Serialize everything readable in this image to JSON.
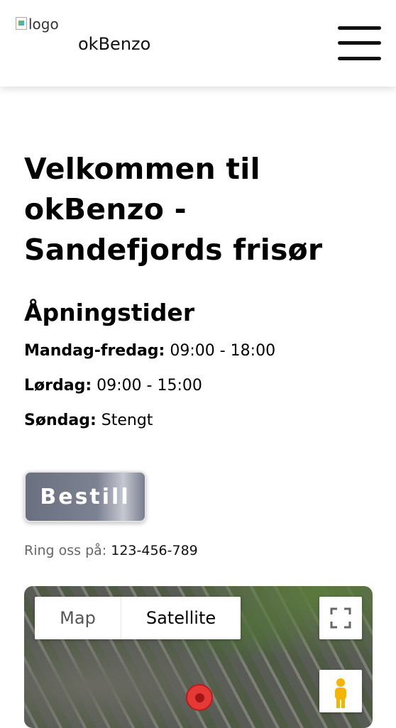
{
  "header": {
    "logo_alt": "logo",
    "brand": "okBenzo"
  },
  "main": {
    "title": "Velkommen til okBenzo - Sandefjords frisør",
    "hours_heading": "Åpningstider",
    "hours": [
      {
        "day": "Mandag-fredag:",
        "time": "09:00 - 18:00"
      },
      {
        "day": "Lørdag:",
        "time": "09:00 - 15:00"
      },
      {
        "day": "Søndag:",
        "time": "Stengt"
      }
    ],
    "book_button": "Bestill",
    "call_label": "Ring oss på:",
    "phone": "123-456-789"
  },
  "map": {
    "type_map": "Map",
    "type_satellite": "Satellite",
    "selected_type": "Satellite",
    "icons": [
      "fullscreen-icon",
      "pegman-icon",
      "map-marker-icon"
    ]
  },
  "colors": {
    "button_gradient_start": "#6b7080",
    "button_gradient_mid": "#c5c8d0",
    "marker": "#e53935"
  }
}
